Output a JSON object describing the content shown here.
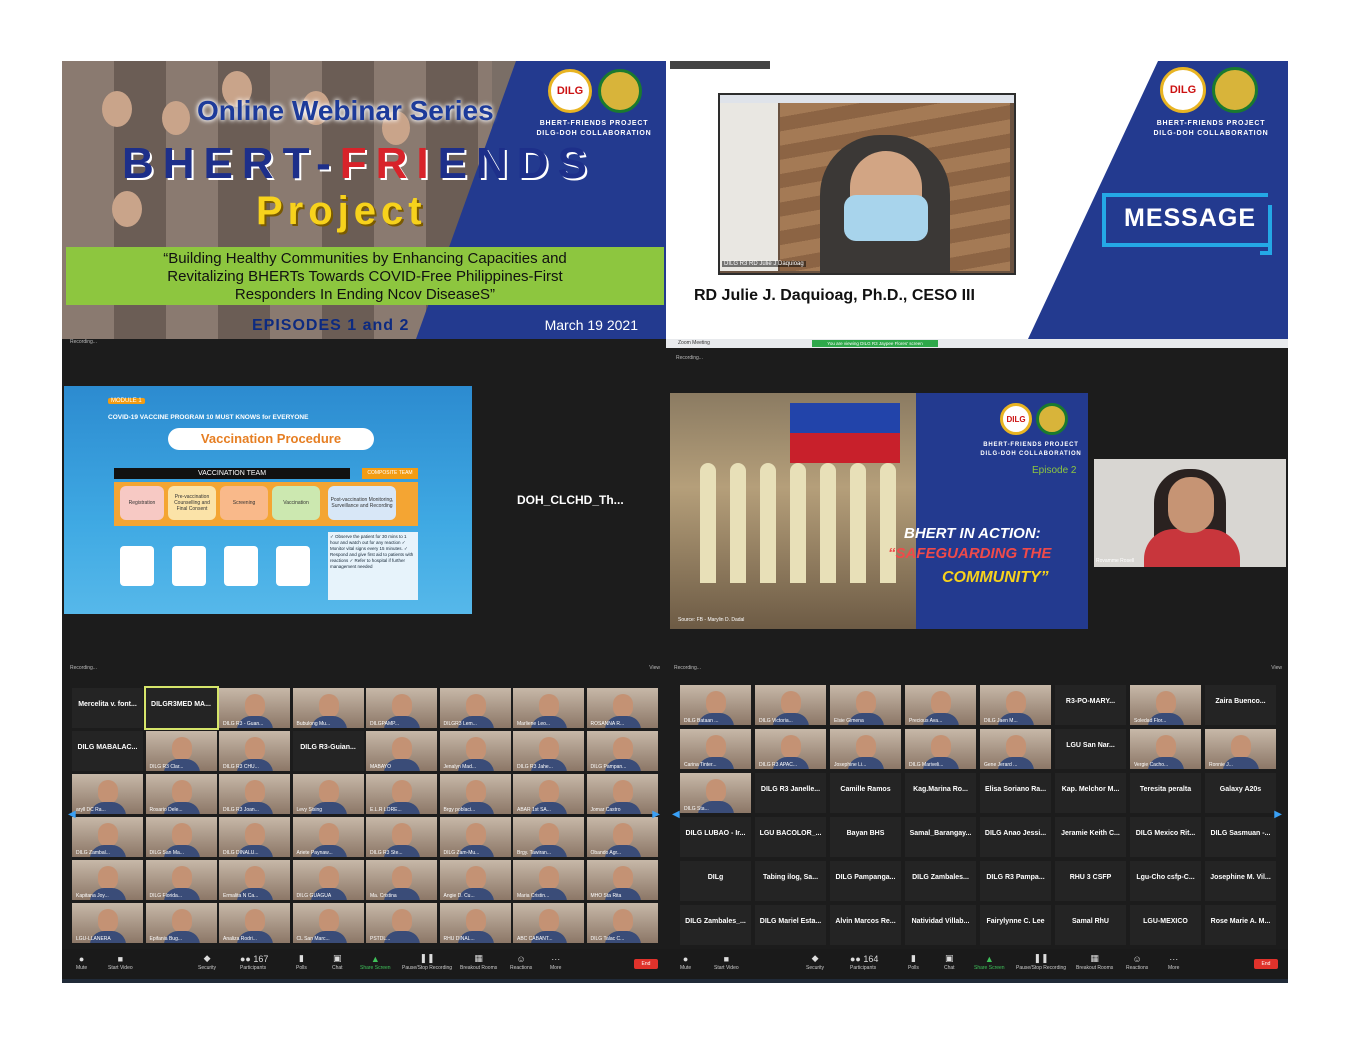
{
  "panel1": {
    "title_line1": "Online Webinar Series",
    "title_line2_a": "BHERT-",
    "title_line2_b": "FRI",
    "title_line2_c": "ENDS",
    "title_line3": "Project",
    "quote_line1": "“Building Healthy Communities by Enhancing Capacities and",
    "quote_line2": "Revitalizing BHERTs Towards COVID-Free Philippines-First",
    "quote_line3": "Responders In Ending Ncov DiseaseS”",
    "episodes": "EPISODES 1 and 2",
    "date": "March 19 2021",
    "project_line1": "BHERT-FRIENDS PROJECT",
    "project_line2": "DILG-DOH COLLABORATION",
    "logo_text": "DILG"
  },
  "panel2": {
    "speaker": "RD Julie J. Daquioag, Ph.D., CESO III",
    "video_name": "DILG R3 RD Julie J Daquioag",
    "message": "MESSAGE",
    "project_line1": "BHERT-FRIENDS PROJECT",
    "project_line2": "DILG-DOH COLLABORATION",
    "logo_text": "DILG"
  },
  "panel3": {
    "module": "MODULE 1",
    "subtitle": "COVID-19 VACCINE PROGRAM 10 MUST KNOWS for EVERYONE",
    "heading": "Vaccination Procedure",
    "team": "VACCINATION TEAM",
    "composite": "COMPOSITE TEAM",
    "steps": [
      "Registration",
      "Pre-vaccination Counselling and Final Consent",
      "Screening",
      "Vaccination",
      "Post-vaccination Monitoring, Surveillance and Recording"
    ],
    "notes": "✓ Observe the patient for 30 mins to 1 hour and watch out for any reaction ✓ Monitor vital signs every 15 minutes. ✓ Respond and give first aid to patients with reactions ✓ Refer to hospital if further management needed",
    "participant": "DOH_CLCHD_Th...",
    "recording": "Recording..."
  },
  "panel4": {
    "titlebar": "Zoom Meeting",
    "viewing": "You are viewing DILG R3 Jaypee Flores' screen",
    "view_options": "View Options",
    "recording": "Recording...",
    "project_line1": "BHERT-FRIENDS PROJECT",
    "project_line2": "DILG-DOH COLLABORATION",
    "episode": "Episode 2",
    "line1": "BHERT IN ACTION:",
    "line2": "“SAFEGUARDING THE",
    "line3": "COMMUNITY”",
    "source": "Source: FB - Marylin D. Dadal",
    "cam_name": "Rovamme Rosell",
    "logo_text": "DILG"
  },
  "gallery_left": {
    "recording": "Recording...",
    "view": "View",
    "tiles": [
      {
        "name": "Mercelita v. font...",
        "video": false
      },
      {
        "name": "DILGR3MED MA...",
        "video": false
      },
      {
        "name": "DILG R3 - Guan...",
        "video": true
      },
      {
        "name": "Bubulong Mu...",
        "video": true
      },
      {
        "name": "DILGPAMP...",
        "video": true
      },
      {
        "name": "DILGR3 Lem...",
        "video": true
      },
      {
        "name": "Marliene Leo...",
        "video": true
      },
      {
        "name": "ROSANNA R...",
        "video": true
      },
      {
        "name": "DILG MABALAC...",
        "video": false
      },
      {
        "name": "DILG R3 Clar...",
        "video": true
      },
      {
        "name": "DILG R3 CHU...",
        "video": true
      },
      {
        "name": "DILG R3-Guian...",
        "video": false
      },
      {
        "name": "MABAYO",
        "video": true
      },
      {
        "name": "Jenalyn Mad...",
        "video": true
      },
      {
        "name": "DILG R3 Jahe...",
        "video": true
      },
      {
        "name": "DILG Pampan...",
        "video": true
      },
      {
        "name": "aryll DC Ra...",
        "video": true
      },
      {
        "name": "Rosario Dele...",
        "video": true
      },
      {
        "name": "DILG R3 Joan...",
        "video": true
      },
      {
        "name": "Levy Sising",
        "video": true
      },
      {
        "name": "E.L.R LORE...",
        "video": true
      },
      {
        "name": "Brgy poblaci...",
        "video": true
      },
      {
        "name": "ABAR 1st SA...",
        "video": true
      },
      {
        "name": "Jomar Castro",
        "video": true
      },
      {
        "name": "DILG Zambal...",
        "video": true
      },
      {
        "name": "DILG San Ma...",
        "video": true
      },
      {
        "name": "DILG DINALU...",
        "video": true
      },
      {
        "name": "Ariete Paynaw...",
        "video": true
      },
      {
        "name": "DILG R3 Ste...",
        "video": true
      },
      {
        "name": "DILG Zam-Mu...",
        "video": true
      },
      {
        "name": "Brgy. Tawiran...",
        "video": true
      },
      {
        "name": "Obando Agr...",
        "video": true
      },
      {
        "name": "Kapitana Joy...",
        "video": true
      },
      {
        "name": "DILG Florida...",
        "video": true
      },
      {
        "name": "Ermalita N Ca...",
        "video": true
      },
      {
        "name": "DILG GUAGUA",
        "video": true
      },
      {
        "name": "Ma. Cristina",
        "video": true
      },
      {
        "name": "Angie D. Cu...",
        "video": true
      },
      {
        "name": "Maria Cristin...",
        "video": true
      },
      {
        "name": "MHO Sta Rita",
        "video": true
      },
      {
        "name": "LGU-LLANERA",
        "video": true
      },
      {
        "name": "Epifania Bug...",
        "video": true
      },
      {
        "name": "Analiza Rodri...",
        "video": true
      },
      {
        "name": "CL San Marc...",
        "video": true
      },
      {
        "name": "PSTDL...",
        "video": true
      },
      {
        "name": "RHU DINAL...",
        "video": true
      },
      {
        "name": "ABC CABANT...",
        "video": true
      },
      {
        "name": "DILG Talac C...",
        "video": true
      }
    ],
    "toolbar": {
      "mute": "Mute",
      "video": "Start Video",
      "security": "Security",
      "participants": "Participants",
      "count": "167",
      "polls": "Polls",
      "chat": "Chat",
      "share": "Share Screen",
      "record": "Pause/Stop Recording",
      "breakout": "Breakout Rooms",
      "reactions": "Reactions",
      "more": "More",
      "end": "End"
    }
  },
  "gallery_right": {
    "recording": "Recording...",
    "view": "View",
    "tiles": [
      {
        "name": "DILG Bataan ...",
        "video": true
      },
      {
        "name": "DILG Victoria...",
        "video": true
      },
      {
        "name": "Elsie Gimena",
        "video": true
      },
      {
        "name": "Precious Ava...",
        "video": true
      },
      {
        "name": "DILG Jaen M...",
        "video": true
      },
      {
        "name": "R3-PO-MARY...",
        "video": false
      },
      {
        "name": "Soledad Flor...",
        "video": true
      },
      {
        "name": "Zaira Buenco...",
        "video": false
      },
      {
        "name": "Carina Tinter...",
        "video": true
      },
      {
        "name": "DILG R3 APAC...",
        "video": true
      },
      {
        "name": "Josephine Li...",
        "video": true
      },
      {
        "name": "DILG Mariveli...",
        "video": true
      },
      {
        "name": "Gene Jerard ...",
        "video": true
      },
      {
        "name": "LGU San Nar...",
        "video": false
      },
      {
        "name": "Vergie Cacho...",
        "video": true
      },
      {
        "name": "Ronnie J...",
        "video": true
      },
      {
        "name": "DILG Sta...",
        "video": true
      },
      {
        "name": "DILG R3 Janelle...",
        "video": false
      },
      {
        "name": "Camille Ramos",
        "video": false
      },
      {
        "name": "Kag.Marina Ro...",
        "video": false
      },
      {
        "name": "Elisa Soriano Ra...",
        "video": false
      },
      {
        "name": "Kap. Melchor M...",
        "video": false
      },
      {
        "name": "Teresita peralta",
        "video": false
      },
      {
        "name": "Galaxy A20s",
        "video": false
      },
      {
        "name": "DILG LUBAO - Ir...",
        "video": false
      },
      {
        "name": "LGU BACOLOR_...",
        "video": false
      },
      {
        "name": "Bayan BHS",
        "video": false
      },
      {
        "name": "Samal_Barangay...",
        "video": false
      },
      {
        "name": "DILG Anao Jessi...",
        "video": false
      },
      {
        "name": "Jeramie Keith C...",
        "video": false
      },
      {
        "name": "DILG Mexico Rit...",
        "video": false
      },
      {
        "name": "DILG Sasmuan -...",
        "video": false
      },
      {
        "name": "DILg",
        "video": false
      },
      {
        "name": "Tabing ilog, Sa...",
        "video": false
      },
      {
        "name": "DILG Pampanga...",
        "video": false
      },
      {
        "name": "DILG Zambales...",
        "video": false
      },
      {
        "name": "DILG R3 Pampa...",
        "video": false
      },
      {
        "name": "RHU 3 CSFP",
        "video": false
      },
      {
        "name": "Lgu-Cho csfp-C...",
        "video": false
      },
      {
        "name": "Josephine M. Vil...",
        "video": false
      },
      {
        "name": "DILG Zambales_...",
        "video": false
      },
      {
        "name": "DILG Mariel Esta...",
        "video": false
      },
      {
        "name": "Alvin Marcos Re...",
        "video": false
      },
      {
        "name": "Natividad Villab...",
        "video": false
      },
      {
        "name": "Fairylynne C. Lee",
        "video": false
      },
      {
        "name": "Samal RhU",
        "video": false
      },
      {
        "name": "LGU-MEXICO",
        "video": false
      },
      {
        "name": "Rose Marie A. M...",
        "video": false
      }
    ],
    "toolbar": {
      "mute": "Mute",
      "video": "Start Video",
      "security": "Security",
      "participants": "Participants",
      "count": "164",
      "polls": "Polls",
      "chat": "Chat",
      "share": "Share Screen",
      "record": "Pause/Stop Recording",
      "breakout": "Breakout Rooms",
      "reactions": "Reactions",
      "more": "More",
      "end": "End"
    }
  }
}
